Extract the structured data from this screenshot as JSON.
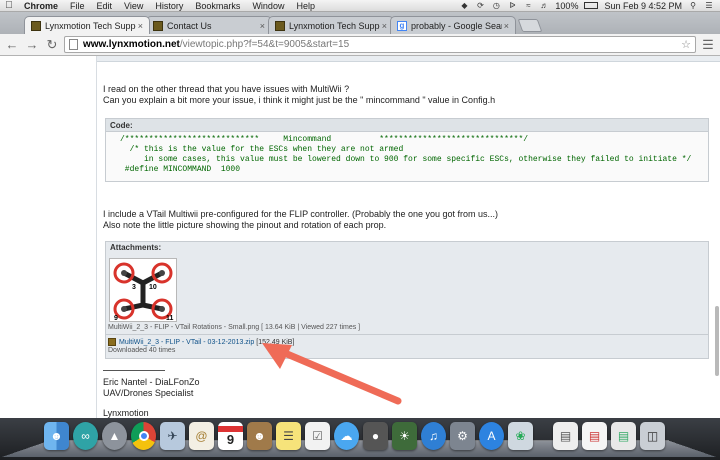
{
  "menubar": {
    "app": "Chrome",
    "items": [
      "File",
      "Edit",
      "View",
      "History",
      "Bookmarks",
      "Window",
      "Help"
    ],
    "battery": "100%",
    "clock": "Sun Feb 9  4:52 PM"
  },
  "tabs": [
    {
      "title": "Lynxmotion Tech Support",
      "favicon": "lynx",
      "active": true
    },
    {
      "title": "Contact Us",
      "favicon": "lynx",
      "active": false
    },
    {
      "title": "Lynxmotion Tech Support",
      "favicon": "lynx",
      "active": false
    },
    {
      "title": "probably - Google Search",
      "favicon": "google",
      "active": false
    }
  ],
  "address": {
    "host": "www.lynxmotion.net",
    "path": "/viewtopic.php?f=54&t=9005&start=15"
  },
  "post": {
    "intro_line1": "I read on the other thread that you have issues with MultiWii ?",
    "intro_line2": "Can you explain a bit more your issue, i think it might just be the \" mincommand \" value in Config.h",
    "code_label": "Code:",
    "code_lines": [
      "/****************************     Mincommand          ******************************/",
      "  /* this is the value for the ESCs when they are not armed",
      "     in some cases, this value must be lowered down to 900 for some specific ESCs, otherwise they failed to initiate */",
      " #define MINCOMMAND  1000"
    ],
    "outro_line1": "I include a VTail Multiwii pre-configured for the FLIP controller. (Probably the one you got from us...)",
    "outro_line2": "Also note the little picture showing the pinout and rotation of each prop."
  },
  "attachments": {
    "label": "Attachments:",
    "image_caption": "MultiWii_2_3 - FLIP - VTail Rotations - Small.png [ 13.64 KiB | Viewed 227 times ]",
    "image_numbers": [
      "3",
      "10",
      "9",
      "11"
    ],
    "file_name": "MultiWii_2_3 - FLIP - VTail - 03-12-2013.zip",
    "file_size": "[152.49 KiB]",
    "downloads": "Downloaded 40 times"
  },
  "signature": {
    "name": "Eric Nantel - DiaLFonZo",
    "role": "UAV/Drones Specialist",
    "company": "Lynxmotion"
  },
  "dock": {
    "calendar_day": "9",
    "icons": [
      "finder-icon",
      "arduino-icon",
      "launchpad-icon",
      "chrome-icon",
      "mail-icon",
      "calendar-icon",
      "contacts-icon",
      "notes-icon",
      "reminders-icon",
      "messages-icon",
      "facetime-icon",
      "photos-icon",
      "itunes-icon",
      "system-prefs-icon",
      "app-store-icon",
      "preview-icon",
      "document-icon",
      "downloads-icon",
      "trash-icon"
    ]
  },
  "colors": {
    "link": "#105289",
    "code_green": "#006600",
    "arrow": "#ef6b57",
    "prop_red": "#d8332b"
  }
}
